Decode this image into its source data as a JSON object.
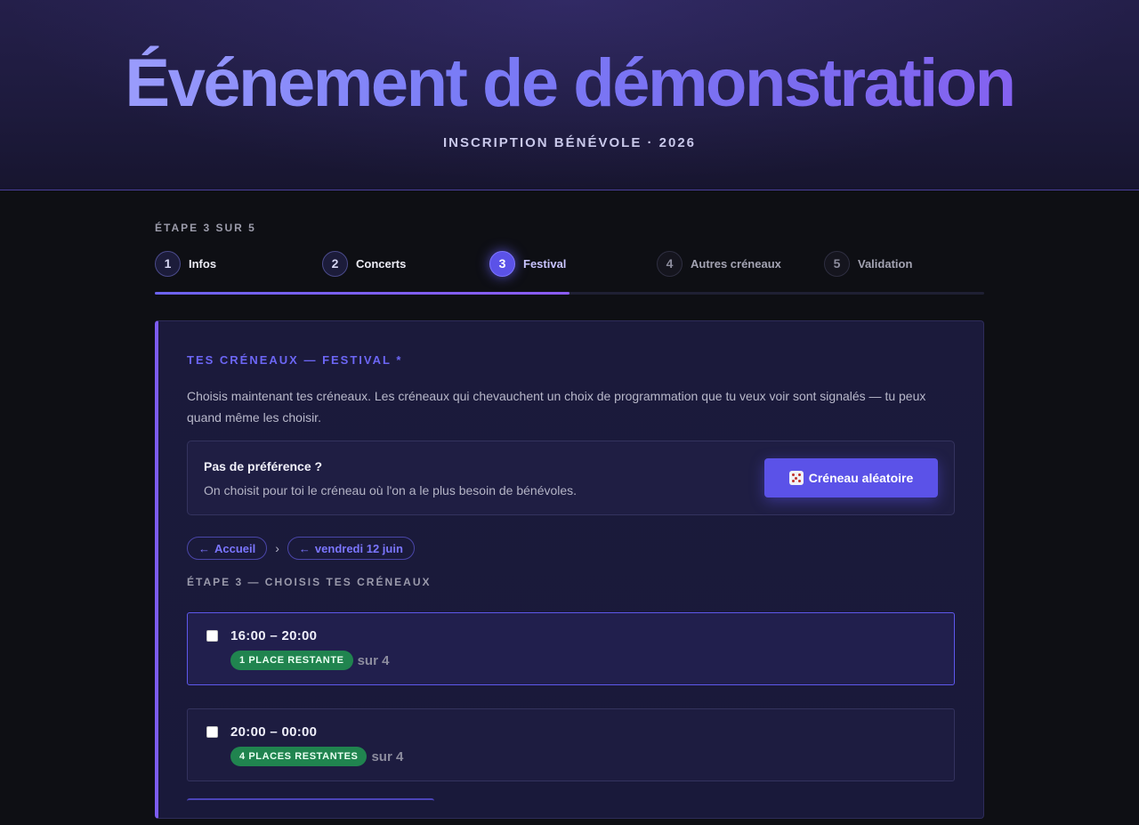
{
  "hero": {
    "title": "Événement de démonstration",
    "subtitle": "INSCRIPTION BÉNÉVOLE · 2026"
  },
  "stepper": {
    "counter": "ÉTAPE 3 SUR 5",
    "progress_fraction": 0.5,
    "steps": [
      {
        "num": "1",
        "label": "Infos",
        "state": "done"
      },
      {
        "num": "2",
        "label": "Concerts",
        "state": "done"
      },
      {
        "num": "3",
        "label": "Festival",
        "state": "active"
      },
      {
        "num": "4",
        "label": "Autres créneaux",
        "state": "future"
      },
      {
        "num": "5",
        "label": "Validation",
        "state": "future"
      }
    ]
  },
  "card": {
    "title": "TES CRÉNEAUX — FESTIVAL *",
    "description": "Choisis maintenant tes créneaux. Les créneaux qui chevauchent un choix de programmation que tu veux voir sont signalés — tu peux quand même les choisir.",
    "preference": {
      "title": "Pas de préférence ?",
      "text": "On choisit pour toi le créneau où l'on a le plus besoin de bénévoles.",
      "button_label": "Créneau aléatoire",
      "button_icon": "dice-icon"
    },
    "breadcrumb": {
      "home": "Accueil",
      "day": "vendredi 12 juin",
      "back_icon": "←",
      "separator": "›"
    },
    "section_heading": "ÉTAPE 3 — CHOISIS TES CRÉNEAUX",
    "slots": [
      {
        "time": "16:00 – 20:00",
        "badge": "1 PLACE RESTANTE",
        "of": "sur 4",
        "checked": false,
        "highlighted": true
      },
      {
        "time": "20:00 – 00:00",
        "badge": "4 PLACES RESTANTES",
        "of": "sur 4",
        "checked": false,
        "highlighted": false
      }
    ]
  },
  "colors": {
    "accent": "#5b52e8",
    "accent_violet": "#7d5cf0",
    "available_badge": "#20844f",
    "background": "#0e0f14"
  }
}
